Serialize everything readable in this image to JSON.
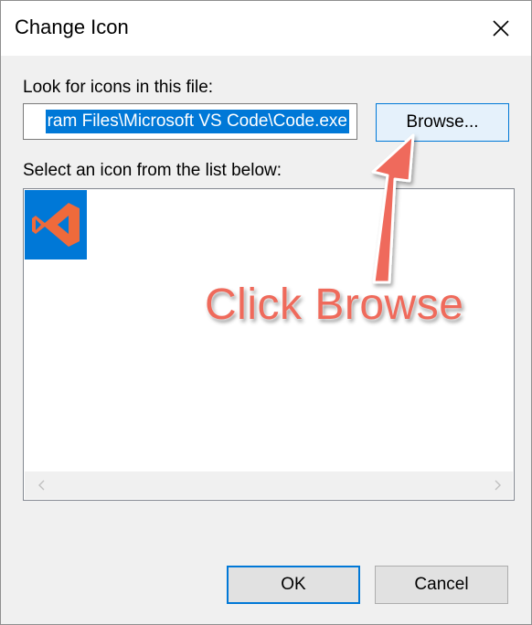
{
  "dialog": {
    "title": "Change Icon"
  },
  "file_section": {
    "label": "Look for icons in this file:",
    "value": "ram Files\\Microsoft VS Code\\Code.exe",
    "browse_label": "Browse..."
  },
  "list_section": {
    "label": "Select an icon from the list below:",
    "items": [
      {
        "icon": "vscode-icon",
        "selected": true
      }
    ]
  },
  "buttons": {
    "ok_label": "OK",
    "cancel_label": "Cancel"
  },
  "annotation": {
    "text": "Click Browse"
  },
  "colors": {
    "accent": "#0078d7",
    "annotation": "#ef6a5b",
    "dialog_bg": "#f0f0f0"
  }
}
